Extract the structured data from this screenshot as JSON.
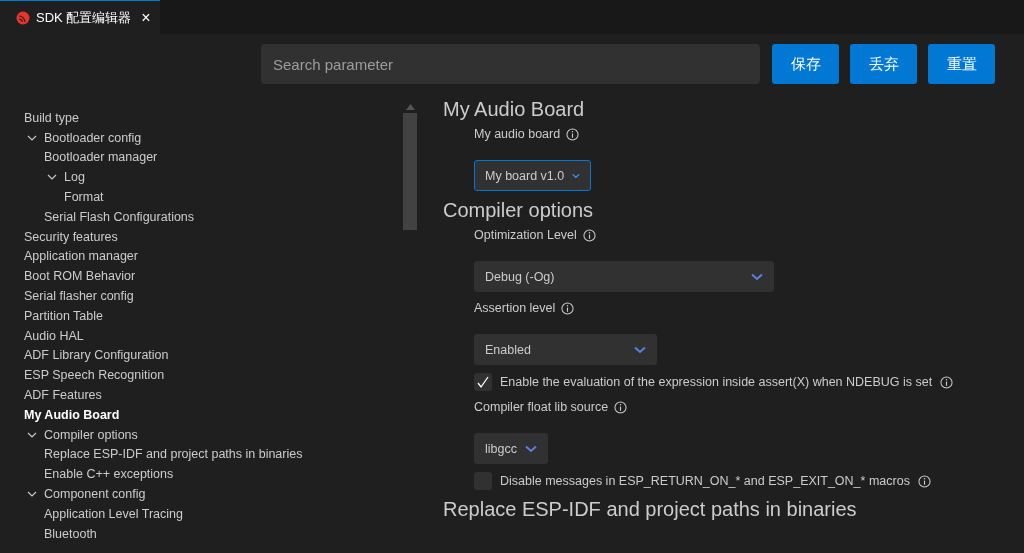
{
  "tab": {
    "title": "SDK 配置编辑器",
    "close": "×"
  },
  "search": {
    "placeholder": "Search parameter"
  },
  "buttons": [
    "保存",
    "丢弃",
    "重置"
  ],
  "tree": [
    {
      "label": "Build type",
      "selected": false
    },
    {
      "label": "Bootloader config",
      "selected": false,
      "expanded": true,
      "children": [
        {
          "label": "Bootloader manager",
          "selected": false
        },
        {
          "label": "Log",
          "selected": false,
          "expanded": true,
          "children": [
            {
              "label": "Format",
              "selected": false
            }
          ]
        },
        {
          "label": "Serial Flash Configurations",
          "selected": false
        }
      ]
    },
    {
      "label": "Security features",
      "selected": false
    },
    {
      "label": "Application manager",
      "selected": false
    },
    {
      "label": "Boot ROM Behavior",
      "selected": false
    },
    {
      "label": "Serial flasher config",
      "selected": false
    },
    {
      "label": "Partition Table",
      "selected": false
    },
    {
      "label": "Audio HAL",
      "selected": false
    },
    {
      "label": "ADF Library Configuration",
      "selected": false
    },
    {
      "label": "ESP Speech Recognition",
      "selected": false
    },
    {
      "label": "ADF Features",
      "selected": false
    },
    {
      "label": "My Audio Board",
      "selected": true
    },
    {
      "label": "Compiler options",
      "selected": false,
      "expanded": true,
      "children": [
        {
          "label": "Replace ESP-IDF and project paths in binaries",
          "selected": false
        },
        {
          "label": "Enable C++ exceptions",
          "selected": false
        }
      ]
    },
    {
      "label": "Component config",
      "selected": false,
      "expanded": true,
      "children": [
        {
          "label": "Application Level Tracing",
          "selected": false
        },
        {
          "label": "Bluetooth",
          "selected": false
        }
      ]
    }
  ],
  "sections": [
    {
      "title": "My Audio Board",
      "settings": [
        {
          "kind": "select",
          "label": "My audio board",
          "value": "My board v1.0",
          "focused": true
        }
      ]
    },
    {
      "title": "Compiler options",
      "settings": [
        {
          "kind": "select",
          "label": "Optimization Level",
          "value": "Debug (-Og)",
          "focused": false
        },
        {
          "kind": "select",
          "label": "Assertion level",
          "value": "Enabled",
          "focused": false
        },
        {
          "kind": "checkbox",
          "label": "Enable the evaluation of the expression inside assert(X) when NDEBUG is set",
          "checked": true
        },
        {
          "kind": "select",
          "label": "Compiler float lib source",
          "value": "libgcc",
          "focused": false
        },
        {
          "kind": "checkbox",
          "label": "Disable messages in ESP_RETURN_ON_* and ESP_EXIT_ON_* macros",
          "checked": false
        }
      ]
    },
    {
      "title": "Replace ESP-IDF and project paths in binaries"
    }
  ]
}
